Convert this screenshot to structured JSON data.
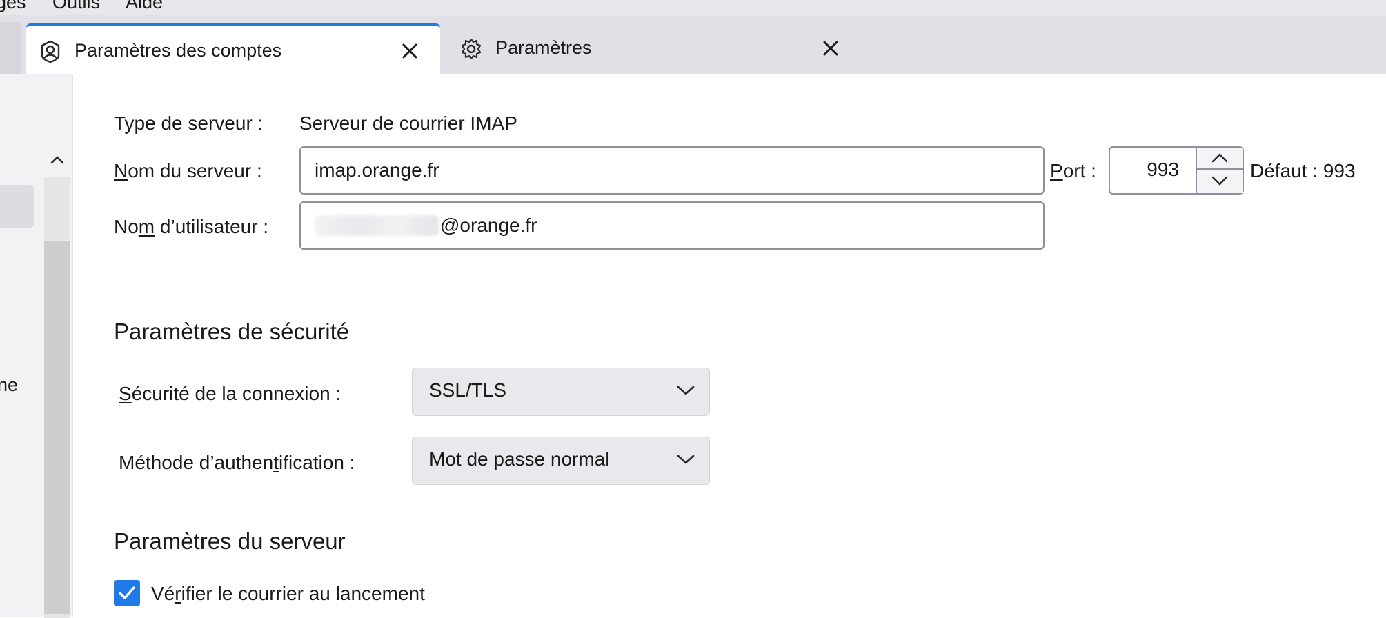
{
  "menubar": {
    "items": [
      "ges",
      "Outils",
      "Aide"
    ]
  },
  "tabs": [
    {
      "label": "Paramètres des comptes",
      "icon": "account-icon",
      "active": true
    },
    {
      "label": "Paramètres",
      "icon": "gear-icon",
      "active": false
    }
  ],
  "sidebar": {
    "cut_text": "ne"
  },
  "server": {
    "type_label": "Type de serveur :",
    "type_value": "Serveur de courrier IMAP",
    "name_label_pre": "",
    "name_label_underline": "N",
    "name_label_post": "om du serveur :",
    "name_value": "imap.orange.fr",
    "port_label_underline": "P",
    "port_label_post": "ort :",
    "port_value": "993",
    "default_label": "Défaut : 993",
    "user_label_pre": "No",
    "user_label_underline": "m",
    "user_label_post": " d’utilisateur :",
    "user_value_suffix": "@orange.fr"
  },
  "security": {
    "heading": "Paramètres de sécurité",
    "connection_label_underline": "S",
    "connection_label_post": "écurité de la connexion :",
    "connection_value": "SSL/TLS",
    "auth_label_pre": "Méthode d’authen",
    "auth_label_underline": "t",
    "auth_label_post": "ification :",
    "auth_value": "Mot de passe normal"
  },
  "server_settings": {
    "heading": "Paramètres du serveur",
    "check_label_pre": "Vé",
    "check_label_underline": "r",
    "check_label_post": "ifier le courrier au lancement",
    "check_checked": true
  },
  "colors": {
    "accent": "#1f7ae8",
    "tab_strip": "#e0e0e6",
    "dropdown_bg": "#e9e9ed"
  }
}
